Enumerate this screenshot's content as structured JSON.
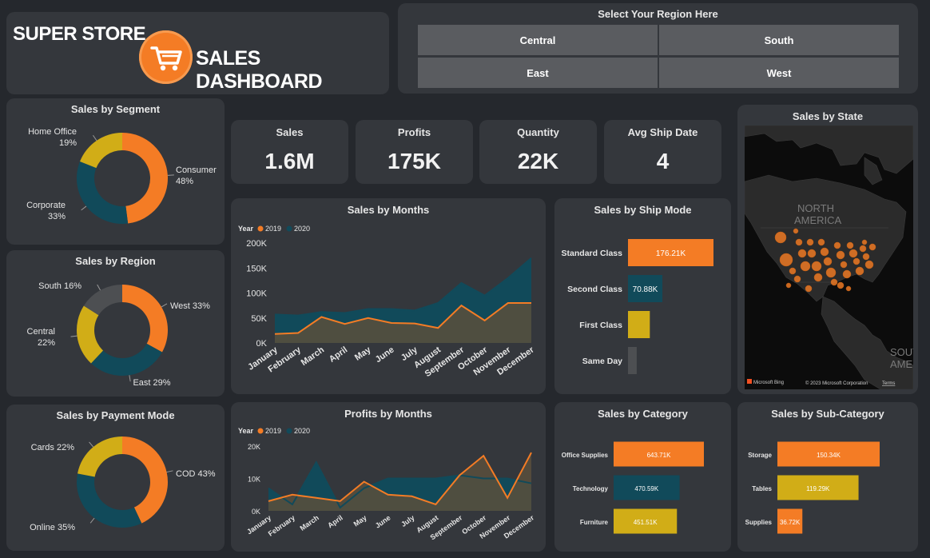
{
  "header": {
    "title_line1": "SUPER STORE",
    "title_line2": "SALES DASHBOARD",
    "logo_icon": "shopping-cart-icon"
  },
  "region_selector": {
    "title": "Select Your Region Here",
    "options": [
      "Central",
      "South",
      "East",
      "West"
    ]
  },
  "kpis": [
    {
      "label": "Sales",
      "value": "1.6M"
    },
    {
      "label": "Profits",
      "value": "175K"
    },
    {
      "label": "Quantity",
      "value": "22K"
    },
    {
      "label": "Avg Ship Date",
      "value": "4"
    }
  ],
  "colors": {
    "orange": "#f47c25",
    "teal": "#114a5a",
    "gold": "#d1ad17",
    "grey": "#4d4f52"
  },
  "map": {
    "title": "Sales by State",
    "region_label_top": "NORTH\nAMERICA",
    "region_label_bottom": "SOUT\nAMER",
    "credit": "Microsoft Bing",
    "copyright": "© 2023 Microsoft Corporation",
    "terms": "Terms"
  },
  "chart_data": [
    {
      "id": "segment",
      "type": "pie",
      "title": "Sales by Segment",
      "categories": [
        "Consumer",
        "Corporate",
        "Home Office"
      ],
      "values": [
        48,
        33,
        19
      ],
      "labels": [
        "Consumer\n48%",
        "Corporate\n33%",
        "Home Office\n19%"
      ]
    },
    {
      "id": "region",
      "type": "pie",
      "title": "Sales by Region",
      "categories": [
        "West",
        "East",
        "Central",
        "South"
      ],
      "values": [
        33,
        29,
        22,
        16
      ],
      "labels": [
        "West 33%",
        "East 29%",
        "Central\n22%",
        "South 16%"
      ]
    },
    {
      "id": "payment",
      "type": "pie",
      "title": "Sales by Payment Mode",
      "categories": [
        "COD",
        "Online",
        "Cards"
      ],
      "values": [
        43,
        35,
        22
      ],
      "labels": [
        "COD 43%",
        "Online 35%",
        "Cards 22%"
      ]
    },
    {
      "id": "sales_months",
      "type": "area",
      "title": "Sales by Months",
      "legend_title": "Year",
      "categories": [
        "January",
        "February",
        "March",
        "April",
        "May",
        "June",
        "July",
        "August",
        "September",
        "October",
        "November",
        "December"
      ],
      "series": [
        {
          "name": "2019",
          "values": [
            18000,
            20000,
            52000,
            38000,
            50000,
            40000,
            39000,
            30000,
            75000,
            45000,
            80000,
            80000
          ]
        },
        {
          "name": "2020",
          "values": [
            57000,
            55000,
            62000,
            60000,
            68000,
            68000,
            65000,
            80000,
            120000,
            95000,
            130000,
            170000
          ]
        }
      ],
      "ylim": [
        0,
        200000
      ],
      "yticks": [
        "0K",
        "50K",
        "100K",
        "150K",
        "200K"
      ]
    },
    {
      "id": "profits_months",
      "type": "area",
      "title": "Profits by Months",
      "legend_title": "Year",
      "categories": [
        "January",
        "February",
        "March",
        "April",
        "May",
        "June",
        "July",
        "August",
        "September",
        "October",
        "November",
        "December"
      ],
      "series": [
        {
          "name": "2019",
          "values": [
            3000,
            5000,
            4000,
            3000,
            9000,
            5000,
            4500,
            2000,
            11000,
            17000,
            4000,
            18000
          ]
        },
        {
          "name": "2020",
          "values": [
            7000,
            2000,
            15000,
            1000,
            7000,
            10000,
            10000,
            10000,
            11000,
            10000,
            10000,
            8500
          ]
        }
      ],
      "ylim": [
        0,
        20000
      ],
      "yticks": [
        "0K",
        "10K",
        "20K"
      ]
    },
    {
      "id": "ship_mode",
      "type": "bar",
      "title": "Sales by Ship Mode",
      "categories": [
        "Standard Class",
        "Second Class",
        "First Class",
        "Same Day"
      ],
      "values": [
        176210,
        70880,
        45000,
        18000
      ],
      "data_labels": [
        "176.21K",
        "70.88K",
        "",
        ""
      ]
    },
    {
      "id": "category",
      "type": "bar",
      "title": "Sales by Category",
      "categories": [
        "Office Supplies",
        "Technology",
        "Furniture"
      ],
      "values": [
        643710,
        470590,
        451510
      ],
      "data_labels": [
        "643.71K",
        "470.59K",
        "451.51K"
      ]
    },
    {
      "id": "sub_category",
      "type": "bar",
      "title": "Sales by Sub-Category",
      "categories": [
        "Storage",
        "Tables",
        "Supplies"
      ],
      "values": [
        150340,
        119290,
        36720
      ],
      "data_labels": [
        "150.34K",
        "119.29K",
        "36.72K"
      ]
    }
  ]
}
